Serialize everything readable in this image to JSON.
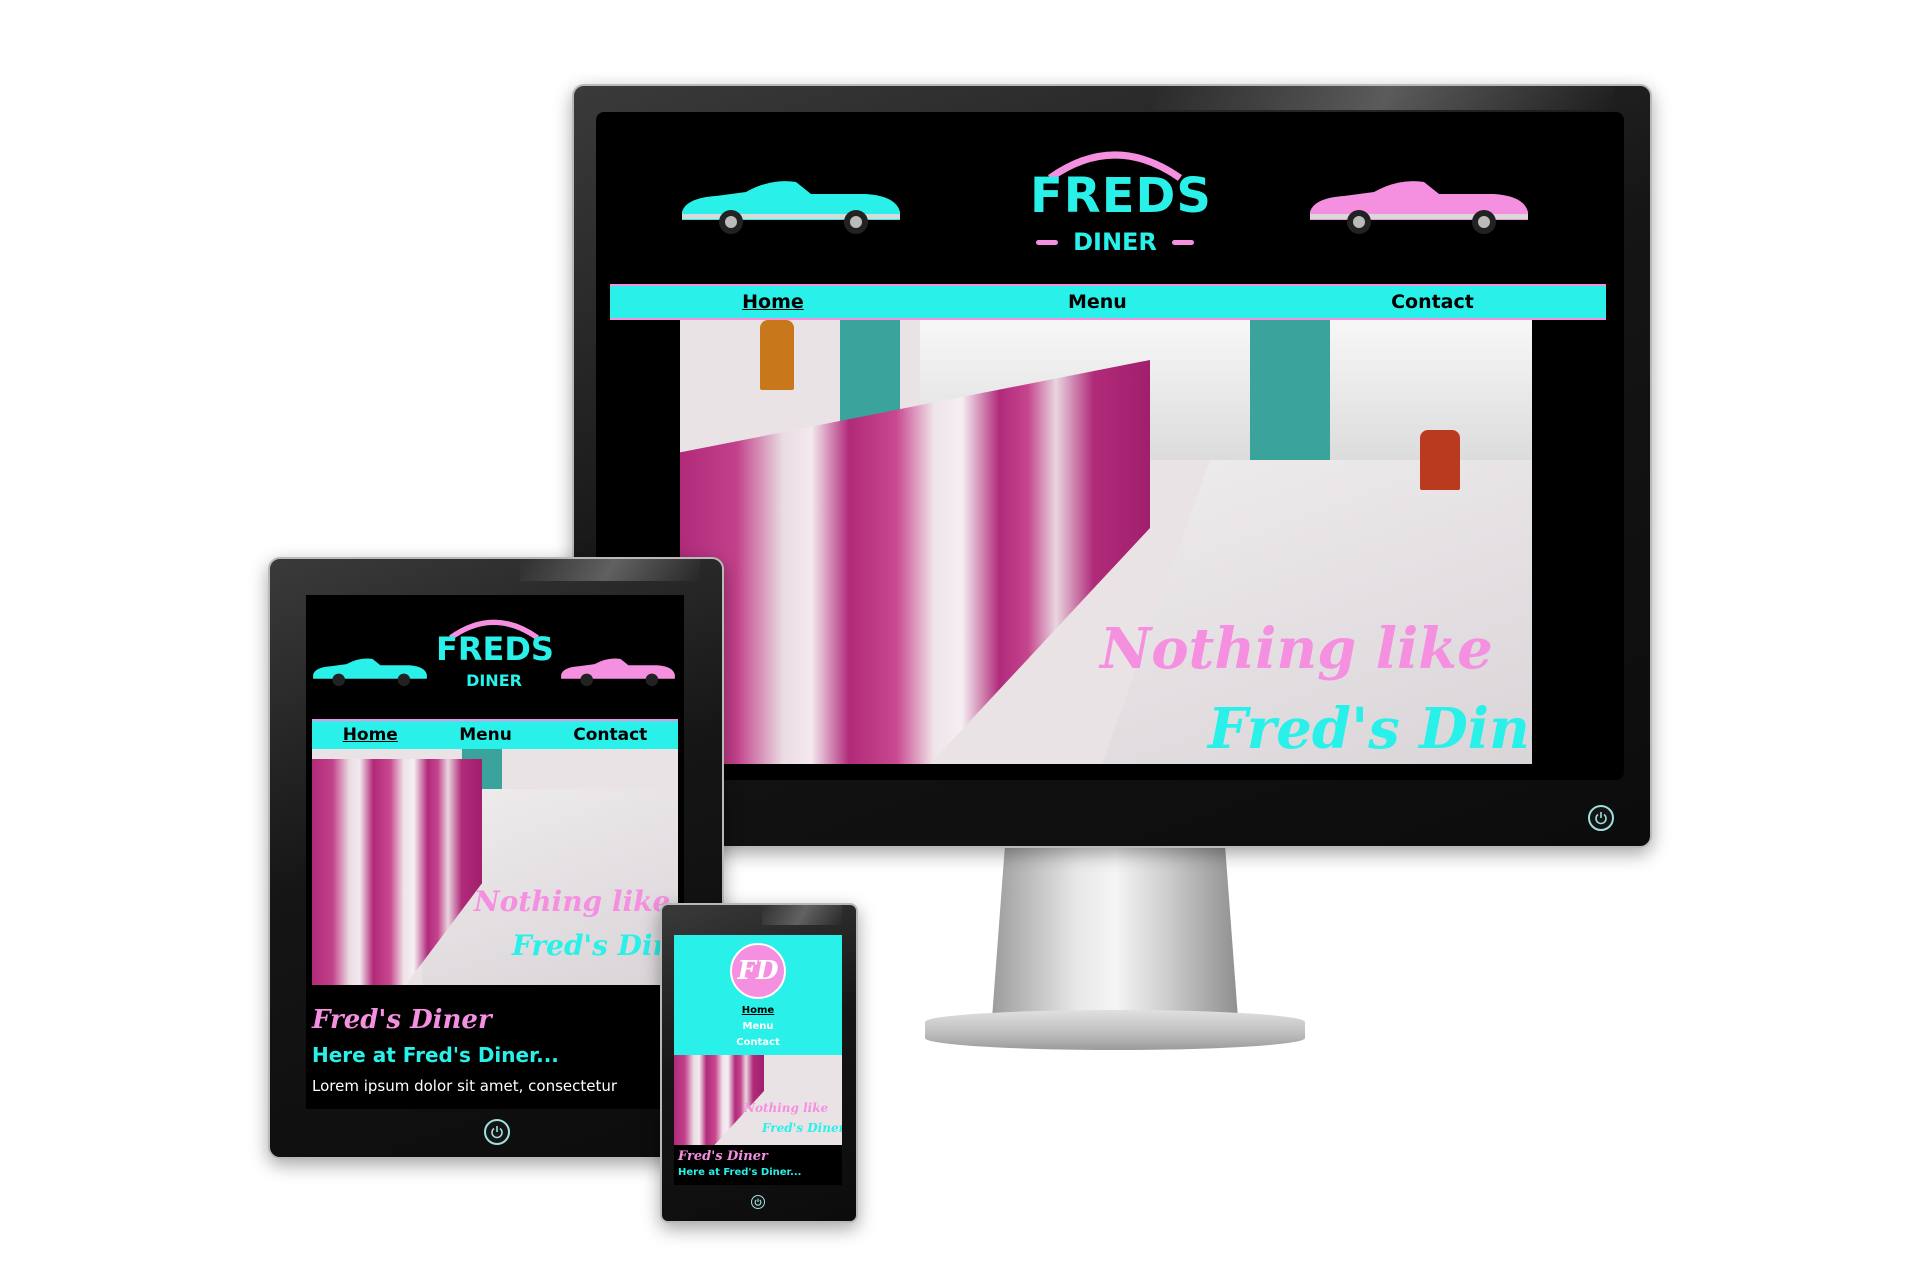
{
  "brand": {
    "logo_top": "FREDS",
    "logo_bottom": "DINER",
    "logo_initials": "FD",
    "colors": {
      "cyan": "#29f0e8",
      "pink": "#f58fe0",
      "black": "#000000",
      "booth": "#b12a7a"
    }
  },
  "nav": {
    "items": [
      "Home",
      "Menu",
      "Contact"
    ],
    "active_index": 0
  },
  "hero": {
    "line1": "Nothing like",
    "line2": "Fred's Diner"
  },
  "content": {
    "title": "Fred's Diner",
    "subtitle": "Here at Fred's Diner...",
    "body": "Lorem ipsum dolor sit amet, consectetur"
  },
  "icons": {
    "power": "power-icon",
    "car": "car-icon"
  }
}
